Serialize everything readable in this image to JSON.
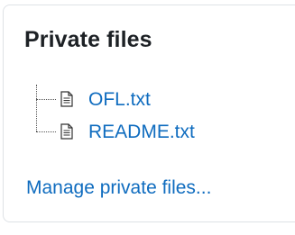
{
  "block": {
    "title": "Private files",
    "files": [
      {
        "name": "OFL.txt",
        "icon": "text-file-icon"
      },
      {
        "name": "README.txt",
        "icon": "text-file-icon"
      }
    ],
    "manage_link": "Manage private files..."
  },
  "colors": {
    "link": "#0f6cbf",
    "title": "#1d2125",
    "border": "#dee2e6"
  }
}
